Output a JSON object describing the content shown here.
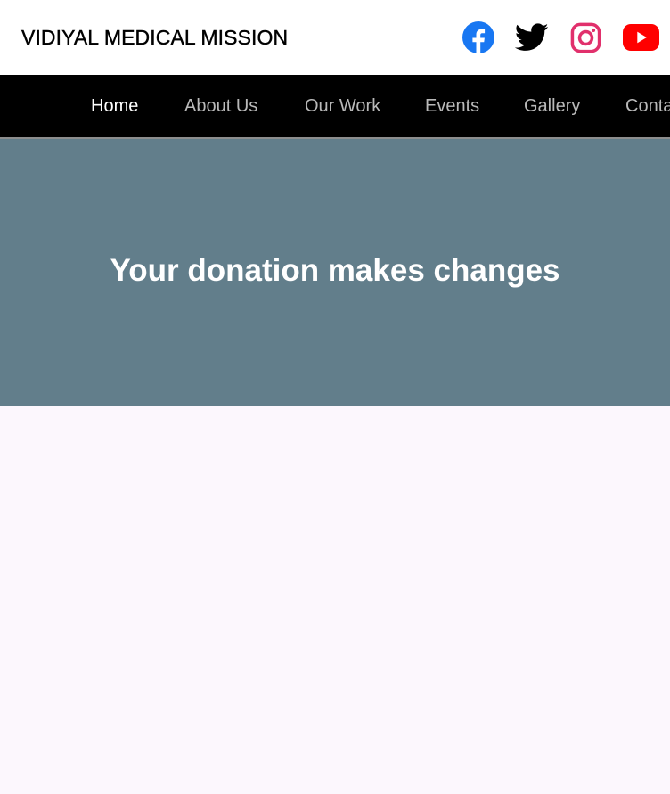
{
  "header": {
    "brand": "VIDIYAL MEDICAL MISSION",
    "social": [
      {
        "name": "facebook-icon",
        "color": "#1877f2"
      },
      {
        "name": "twitter-icon",
        "color": "#000000"
      },
      {
        "name": "instagram-icon",
        "color": "#e1306c"
      },
      {
        "name": "youtube-icon",
        "color": "#ff0000"
      }
    ]
  },
  "nav": {
    "items": [
      {
        "label": "Home",
        "active": true
      },
      {
        "label": "About Us",
        "active": false
      },
      {
        "label": "Our Work",
        "active": false
      },
      {
        "label": "Events",
        "active": false
      },
      {
        "label": "Gallery",
        "active": false
      },
      {
        "label": "Conta",
        "active": false
      }
    ]
  },
  "hero": {
    "title": "Your donation makes changes",
    "background": "#627e8b"
  },
  "colors": {
    "nav_bg": "#000000",
    "nav_active": "#ffffff",
    "nav_inactive": "#b9b9b9",
    "page_bg": "#fcf7fd"
  }
}
